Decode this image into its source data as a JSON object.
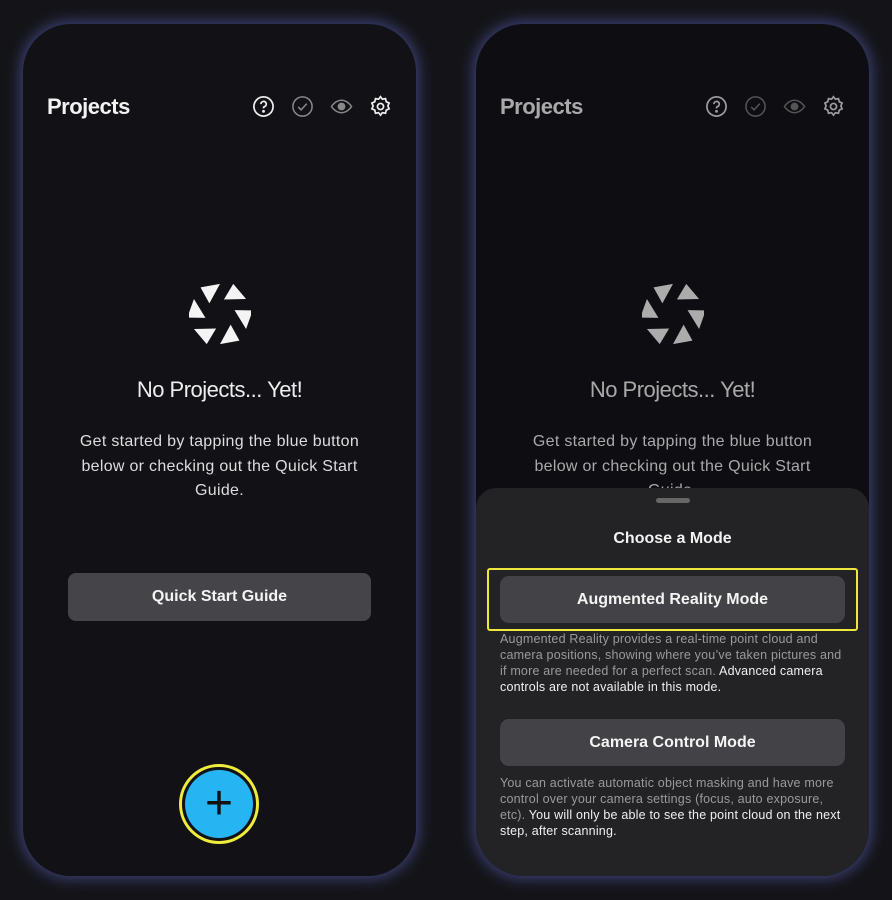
{
  "screens": [
    {
      "header": {
        "title": "Projects",
        "icons": [
          "help-circle-icon",
          "check-circle-icon",
          "eye-icon",
          "gear-icon"
        ]
      },
      "empty": {
        "heading": "No Projects... Yet!",
        "body": "Get started by tapping the blue button below or checking out the Quick Start Guide."
      },
      "quick_start_label": "Quick Start Guide",
      "fab_label": "+"
    },
    {
      "header": {
        "title": "Projects"
      },
      "empty": {
        "heading": "No Projects... Yet!",
        "body": "Get started by tapping the blue button below or checking out the Quick Start Guide."
      }
    }
  ],
  "sheet": {
    "title": "Choose a Mode",
    "modes": [
      {
        "label": "Augmented Reality Mode",
        "desc_muted": "Augmented Reality provides a real-time point cloud and camera positions, showing where you’ve taken pictures and if more are needed for a perfect scan. ",
        "desc_strong": "Advanced camera controls are not available in this mode."
      },
      {
        "label": "Camera Control Mode",
        "desc_muted": "You can activate automatic object masking and have more control over your camera settings (focus, auto exposure, etc). ",
        "desc_strong": "You will only be able to see the point cloud on the next step, after scanning."
      }
    ]
  },
  "colors": {
    "accent": "#27b4f3",
    "highlight": "#ede83a"
  }
}
